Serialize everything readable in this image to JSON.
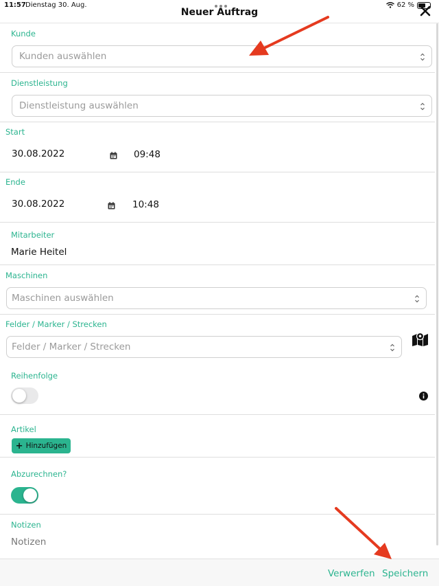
{
  "status_bar": {
    "time": "11:57",
    "date": "Dienstag 30. Aug.",
    "battery": "62 %",
    "battery_level": 0.62
  },
  "header": {
    "title": "Neuer Auftrag"
  },
  "kunde": {
    "label": "Kunde",
    "placeholder": "Kunden auswählen"
  },
  "dienstleistung": {
    "label": "Dienstleistung",
    "placeholder": "Dienstleistung auswählen"
  },
  "start": {
    "label": "Start",
    "date": "30.08.2022",
    "time": "09:48"
  },
  "ende": {
    "label": "Ende",
    "date": "30.08.2022",
    "time": "10:48"
  },
  "mitarbeiter": {
    "label": "Mitarbeiter",
    "value": "Marie Heitel"
  },
  "maschinen": {
    "label": "Maschinen",
    "placeholder": "Maschinen auswählen"
  },
  "felder": {
    "label": "Felder / Marker / Strecken",
    "placeholder": "Felder / Marker / Strecken"
  },
  "reihenfolge": {
    "label": "Reihenfolge",
    "enabled": false
  },
  "artikel": {
    "label": "Artikel",
    "add_label": "Hinzufügen"
  },
  "abzurechnen": {
    "label": "Abzurechnen?",
    "enabled": true
  },
  "notizen": {
    "label": "Notizen",
    "placeholder": "Notizen"
  },
  "footer": {
    "discard_label": "Verwerfen",
    "save_label": "Speichern"
  },
  "colors": {
    "accent": "#2bb48f",
    "annotation_arrow": "#e53a1f"
  },
  "icons": [
    "wifi-icon",
    "battery-icon",
    "close-icon",
    "chevron-updown-icon",
    "calendar-icon",
    "map-icon",
    "info-icon",
    "plus-icon"
  ]
}
